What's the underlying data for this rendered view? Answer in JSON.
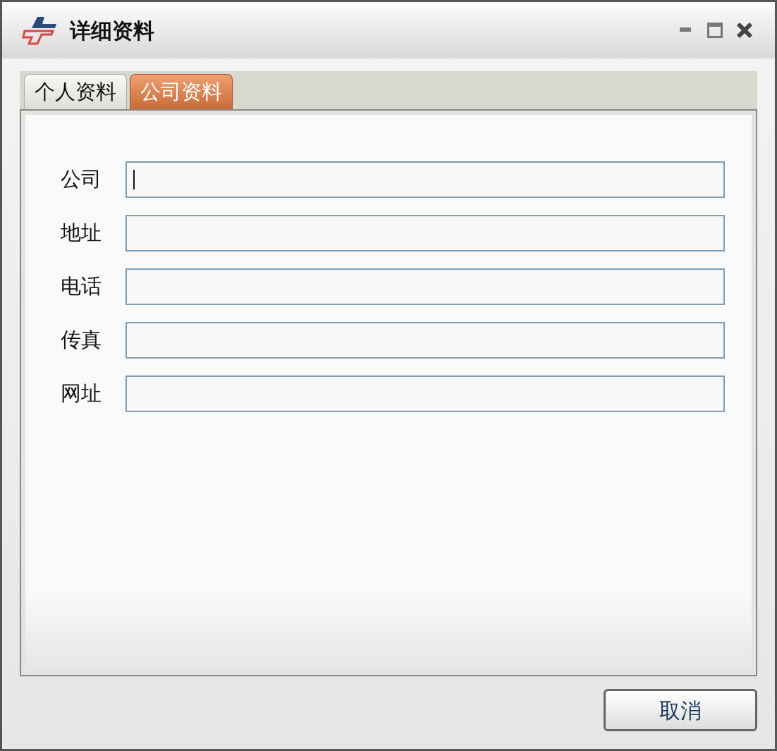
{
  "window": {
    "title": "详细资料"
  },
  "tabs": [
    {
      "label": "个人资料",
      "selected": false
    },
    {
      "label": "公司资料",
      "selected": true
    }
  ],
  "fields": [
    {
      "label": "公司",
      "focused": true
    },
    {
      "label": "地址",
      "focused": false
    },
    {
      "label": "电话",
      "focused": false
    },
    {
      "label": "传真",
      "focused": false
    },
    {
      "label": "网址",
      "focused": false
    }
  ],
  "buttons": [
    "取消"
  ]
}
